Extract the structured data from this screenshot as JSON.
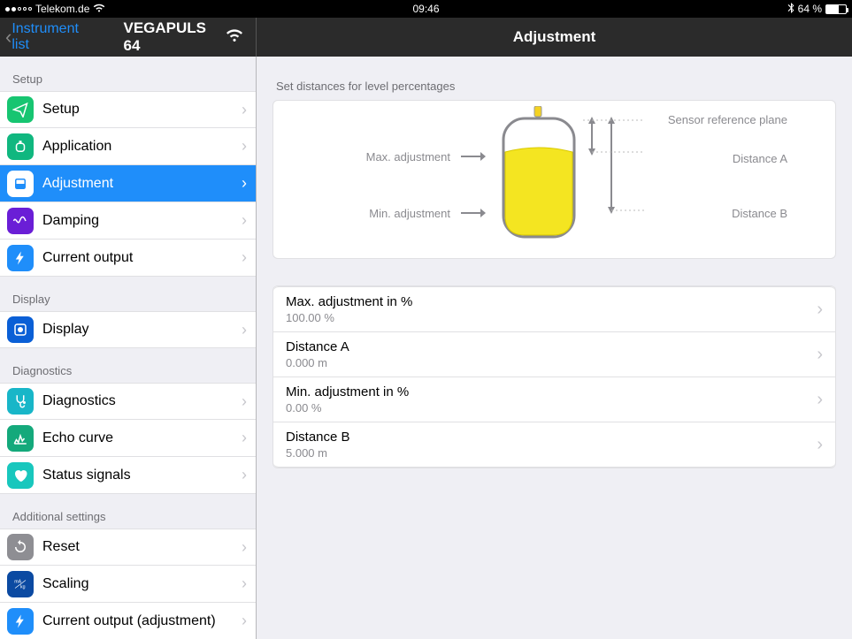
{
  "status": {
    "carrier": "Telekom.de",
    "time": "09:46",
    "battery": "64 %"
  },
  "nav": {
    "back": "Instrument list",
    "device": "VEGAPULS 64",
    "title": "Adjustment"
  },
  "sidebar": {
    "groups": [
      {
        "title": "Setup",
        "items": [
          {
            "label": "Setup"
          },
          {
            "label": "Application"
          },
          {
            "label": "Adjustment"
          },
          {
            "label": "Damping"
          },
          {
            "label": "Current output"
          }
        ]
      },
      {
        "title": "Display",
        "items": [
          {
            "label": "Display"
          }
        ]
      },
      {
        "title": "Diagnostics",
        "items": [
          {
            "label": "Diagnostics"
          },
          {
            "label": "Echo curve"
          },
          {
            "label": "Status signals"
          }
        ]
      },
      {
        "title": "Additional settings",
        "items": [
          {
            "label": "Reset"
          },
          {
            "label": "Scaling"
          },
          {
            "label": "Current output (adjustment)"
          }
        ]
      }
    ]
  },
  "detail": {
    "header": "Set distances for level percentages",
    "diagram": {
      "sensor_ref": "Sensor reference plane",
      "max_adj": "Max. adjustment",
      "min_adj": "Min. adjustment",
      "dist_a": "Distance A",
      "dist_b": "Distance B"
    },
    "rows": [
      {
        "title": "Max. adjustment in %",
        "value": "100.00 %"
      },
      {
        "title": "Distance A",
        "value": "0.000 m"
      },
      {
        "title": "Min. adjustment in %",
        "value": "0.00 %"
      },
      {
        "title": "Distance B",
        "value": "5.000 m"
      }
    ]
  }
}
